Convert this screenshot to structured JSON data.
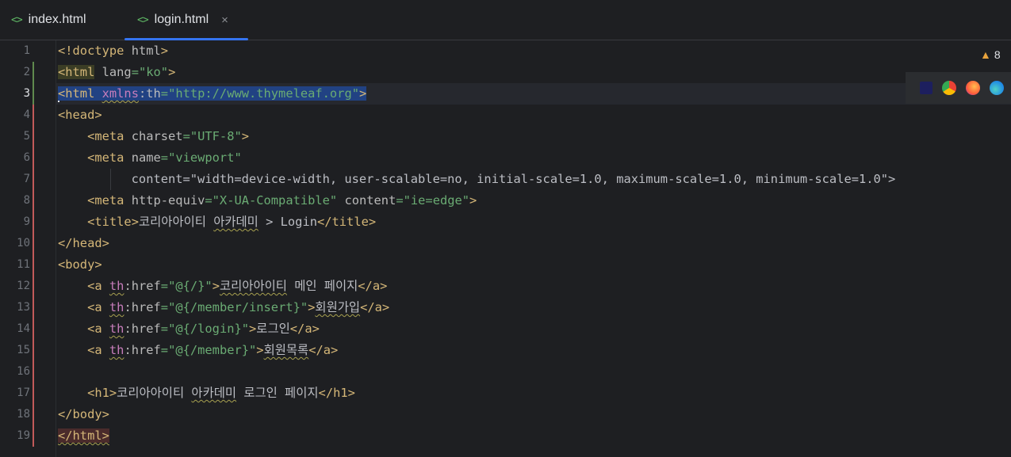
{
  "tabs": [
    {
      "label": "index.html",
      "icon": "html-file-icon"
    },
    {
      "label": "login.html",
      "icon": "html-file-icon",
      "active": true,
      "close": "×"
    }
  ],
  "warnings": {
    "icon": "warning-icon",
    "count": "8"
  },
  "browsers": [
    "intellij-icon",
    "chrome-icon",
    "firefox-icon",
    "edge-icon"
  ],
  "editor": {
    "current_line": 3,
    "line_numbers": [
      "1",
      "2",
      "3",
      "4",
      "5",
      "6",
      "7",
      "8",
      "9",
      "10",
      "11",
      "12",
      "13",
      "14",
      "15",
      "16",
      "17",
      "18",
      "19"
    ],
    "lines": [
      "<!doctype html>",
      "<html lang=\"ko\">",
      "<html xmlns:th=\"http://www.thymeleaf.org\">",
      "<head>",
      "    <meta charset=\"UTF-8\">",
      "    <meta name=\"viewport\"",
      "          content=\"width=device-width, user-scalable=no, initial-scale=1.0, maximum-scale=1.0, minimum-scale=1.0\">",
      "    <meta http-equiv=\"X-UA-Compatible\" content=\"ie=edge\">",
      "    <title>코리아아이티 아카데미 > Login</title>",
      "</head>",
      "<body>",
      "    <a th:href=\"@{/}\">코리아아이티 메인 페이지</a>",
      "    <a th:href=\"@{/member/insert}\">회원가입</a>",
      "    <a th:href=\"@{/login}\">로그인</a>",
      "    <a th:href=\"@{/member}\">회원목록</a>",
      "",
      "    <h1>코리아아이티 아카데미 로그인 페이지</h1>",
      "</body>",
      "</html>"
    ]
  }
}
